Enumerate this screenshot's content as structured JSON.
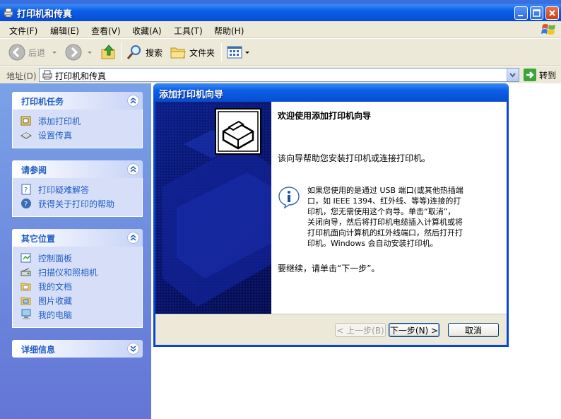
{
  "window": {
    "title": "打印机和传真"
  },
  "menu": [
    "文件(F)",
    "编辑(E)",
    "查看(V)",
    "收藏(A)",
    "工具(T)",
    "帮助(H)"
  ],
  "toolbar": {
    "back": "后退",
    "search": "搜索",
    "folders": "文件夹"
  },
  "address": {
    "label": "地址(D)",
    "value": "打印机和传真",
    "go": "转到"
  },
  "taskpane": {
    "printer_tasks": {
      "title": "打印机任务",
      "items": [
        "添加打印机",
        "设置传真"
      ]
    },
    "see_also": {
      "title": "请参阅",
      "items": [
        "打印疑难解答",
        "获得关于打印的帮助"
      ]
    },
    "other_places": {
      "title": "其它位置",
      "items": [
        "控制面板",
        "扫描仪和照相机",
        "我的文档",
        "图片收藏",
        "我的电脑"
      ]
    },
    "details": {
      "title": "详细信息"
    }
  },
  "wizard": {
    "title": "添加打印机向导",
    "heading": "欢迎使用添加打印机向导",
    "intro": "该向导帮助您安装打印机或连接打印机。",
    "info_lines": [
      "如果您使用的是通过 USB 端口(或其他热插端",
      "口，如 IEEE 1394、红外线、等等)连接的打",
      "印机，您无需使用这个向导。单击“取消”，",
      "关闭向导，然后将打印机电缆插入计算机或将",
      "打印机面向计算机的红外线端口，然后打开打",
      "印机。Windows 会自动安装打印机。"
    ],
    "continue": "要继续，请单击“下一步”。",
    "buttons": {
      "back": "< 上一步(B)",
      "next": "下一步(N) >",
      "cancel": "取消"
    }
  },
  "colors": {
    "titlebar": "#0a5ee6",
    "taskpane": "#6f8fe0",
    "link": "#215dc6",
    "wizard_side": "#071266"
  }
}
